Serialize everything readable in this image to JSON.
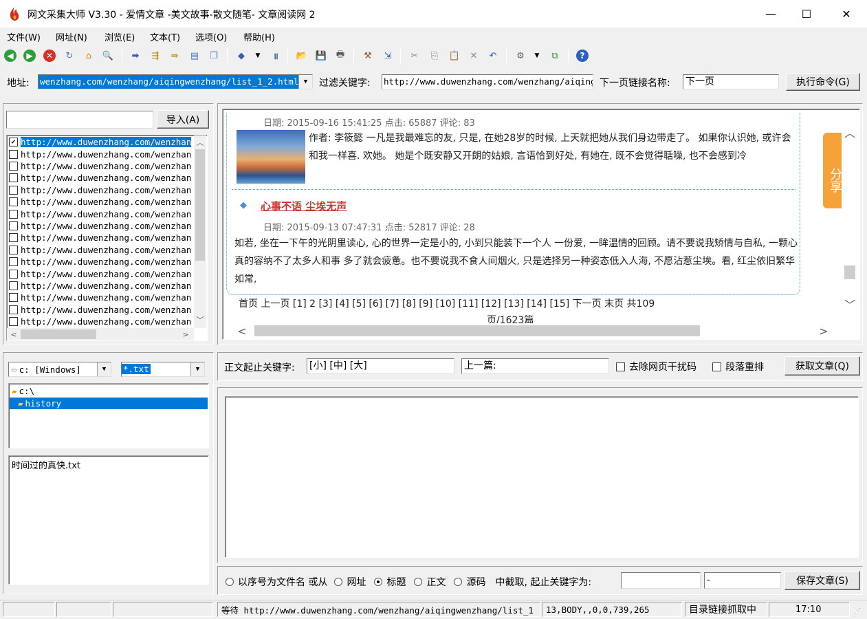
{
  "window": {
    "title": "网文采集大师 V3.30 - 爱情文章 -美文故事-散文随笔- 文章阅读网 2",
    "minimize": "—",
    "maximize": "☐",
    "close": "✕"
  },
  "menu": [
    "文件(W)",
    "网址(N)",
    "浏览(E)",
    "文本(T)",
    "选项(O)",
    "帮助(H)"
  ],
  "address": {
    "label": "地址:",
    "value": "wenzhang.com/wenzhang/aiqingwenzhang/list_1_2.html",
    "filter_label": "过滤关键字:",
    "filter_value": "http://www.duwenzhang.com/wenzhang/aiqing",
    "next_label": "下一页链接名称:",
    "next_value": "下一页",
    "execute": "执行命令(G)"
  },
  "url_panel": {
    "import_button": "导入(A)",
    "search_value": "",
    "urls": [
      "http://www.duwenzhang.com/wenzhan",
      "http://www.duwenzhang.com/wenzhan",
      "http://www.duwenzhang.com/wenzhan",
      "http://www.duwenzhang.com/wenzhan",
      "http://www.duwenzhang.com/wenzhan",
      "http://www.duwenzhang.com/wenzhan",
      "http://www.duwenzhang.com/wenzhan",
      "http://www.duwenzhang.com/wenzhan",
      "http://www.duwenzhang.com/wenzhan",
      "http://www.duwenzhang.com/wenzhan",
      "http://www.duwenzhang.com/wenzhan",
      "http://www.duwenzhang.com/wenzhan",
      "http://www.duwenzhang.com/wenzhan",
      "http://www.duwenzhang.com/wenzhan",
      "http://www.duwenzhang.com/wenzhan",
      "http://www.duwenzhang.com/wenzhan"
    ],
    "checked_index": 0
  },
  "browser": {
    "article1": {
      "meta": "日期: 2015-09-16 15:41:25 点击: 65887 评论: 83",
      "body": "作者: 李筱懿 一凡是我最难忘的友, 只是, 在她28岁的时候, 上天就把她从我们身边带走了。 如果你认识她, 或许会和我一样喜. 欢她。 她是个既安静又开朗的姑娘, 言语恰到好处, 有她在, 既不会觉得聒噪, 也不会感到冷"
    },
    "article2": {
      "title": "心事不语 尘埃无声",
      "meta": "日期: 2015-09-13 07:47:31 点击: 52817 评论: 28",
      "body": "如若, 坐在一下午的光阴里读心, 心的世界一定是小的, 小到只能装下一个人 一份爱, 一眸温情的回顾。请不要说我矫情与自私, 一颗心真的容纳不了太多人和事 多了就会疲惫。也不要说我不食人间烟火, 只是选择另一种姿态低入人海, 不愿沾惹尘埃。看, 红尘依旧繁华如常,"
    },
    "pager": "首页 上一页 [1] 2 [3] [4] [5] [6] [7] [8] [9] [10] [11] [12] [13] [14] [15] 下一页 末页 共109",
    "pager2": "页/1623篇",
    "share": "分享"
  },
  "files": {
    "drive": "c: [Windows]",
    "filter": "*.txt",
    "tree": [
      "c:\\",
      "history"
    ],
    "list": [
      "时间过的真快.txt"
    ]
  },
  "extract": {
    "start_label": "正文起止关键字:",
    "start_value": "[小] [中] [大]",
    "prev_value": "上一篇:",
    "remove_noise": "去除网页干扰码",
    "reorder": "段落重排",
    "get_button": "获取文章(Q)"
  },
  "save": {
    "opt_seq": "以序号为文件名 或从",
    "opt_url": "网址",
    "opt_title": "标题",
    "opt_body": "正文",
    "opt_source": "源码",
    "mid_label": "中截取, 起止关键字为:",
    "kw1": "",
    "kw2": "-",
    "save_button": "保存文章(S)"
  },
  "status": {
    "wait": "等待 http://www.duwenzhang.com/wenzhang/aiqingwenzhang/list_1",
    "pos": "13,BODY,,0,0,739,265",
    "task": "目录链接抓取中",
    "time": "17:10"
  },
  "colors": {
    "selection": "#0078d7",
    "link_red": "#c0392b",
    "share_orange": "#f5a23a",
    "dotted_border": "#4a9fd8"
  }
}
